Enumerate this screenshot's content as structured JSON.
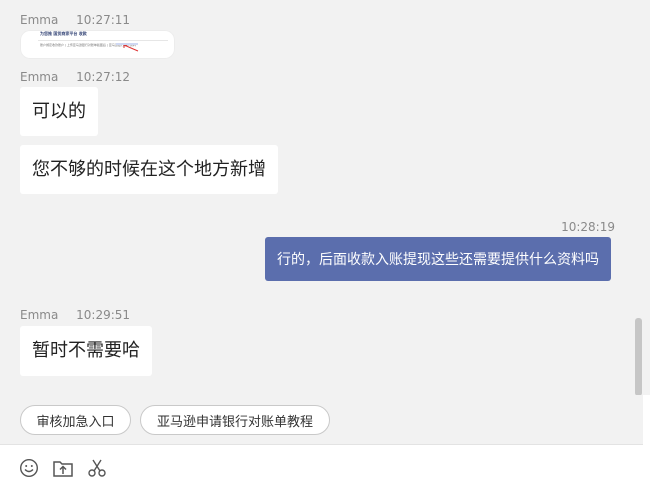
{
  "messages": [
    {
      "sender": "Emma",
      "time": "10:27:11",
      "type": "image",
      "image": {
        "title": "为您推 国货商家平台 收款",
        "line": "账户绑定收款账户 | 上传亚马逊银行对账单截图后 | 亚马逊银行账户资料"
      }
    },
    {
      "sender": "Emma",
      "time": "10:27:12",
      "type": "text",
      "text": "可以的"
    },
    {
      "type": "text",
      "text": "您不够的时候在这个地方新增"
    },
    {
      "sender": "",
      "time": "10:28:19",
      "type": "outgoing",
      "text": "行的，后面收款入账提现这些还需要提供什么资料吗"
    },
    {
      "sender": "Emma",
      "time": "10:29:51",
      "type": "text",
      "text": "暂时不需要哈"
    }
  ],
  "quick_replies": [
    "审核加急入口",
    "亚马逊申请银行对账单教程"
  ],
  "toolbar": {
    "icons": [
      "emoji-icon",
      "upload-file-icon",
      "scissors-icon"
    ]
  },
  "colors": {
    "chat_background": "#f2f2f2",
    "outgoing_bubble": "#5b6ead",
    "incoming_bubble": "#ffffff"
  }
}
